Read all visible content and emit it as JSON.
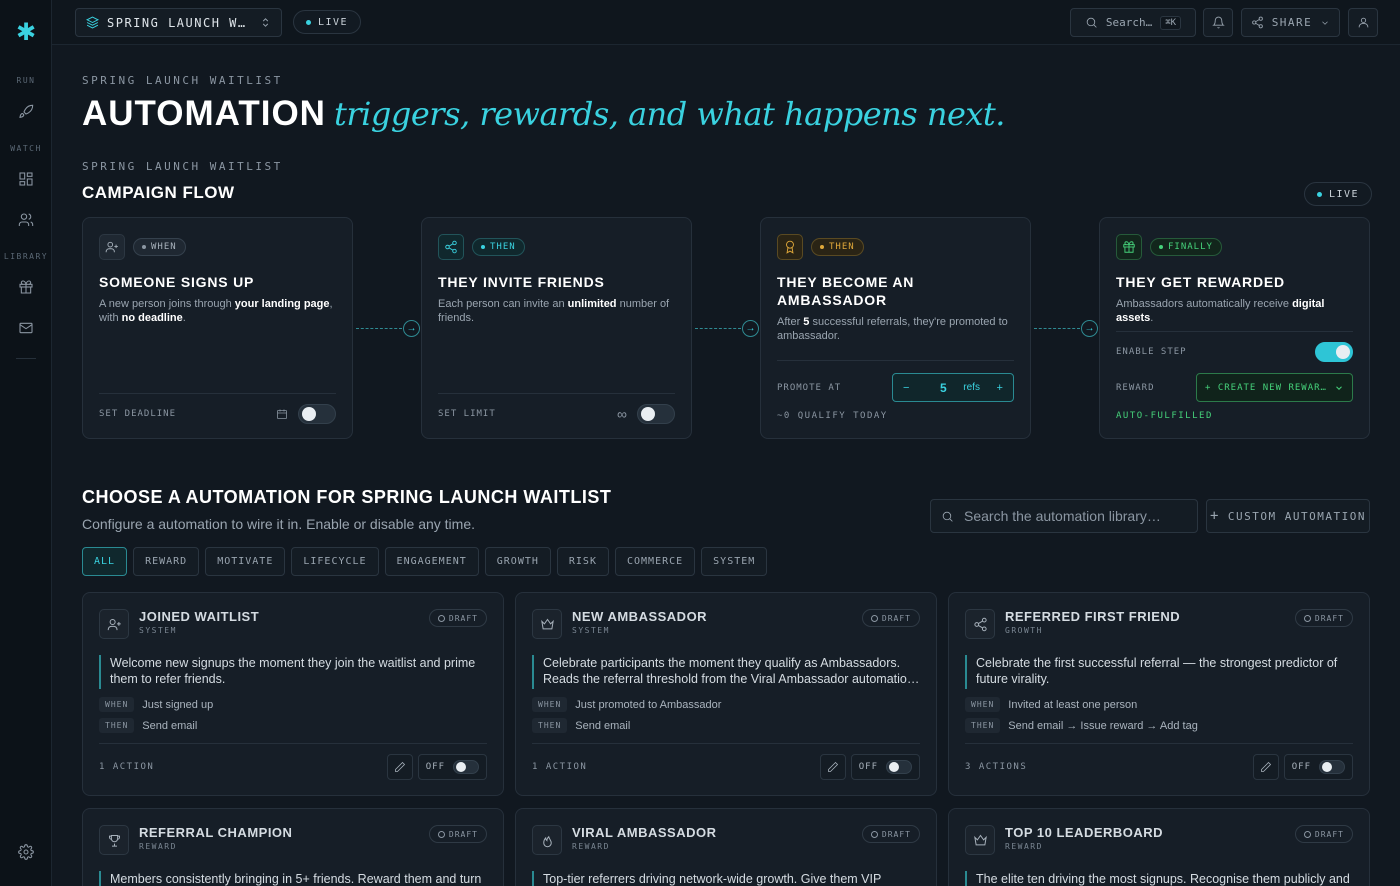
{
  "topbar": {
    "project": "SPRING LAUNCH WAI…",
    "live": "LIVE",
    "search_label": "Search…",
    "search_kbd": "⌘K",
    "share": "SHARE"
  },
  "sidebar": {
    "sections": [
      "RUN",
      "WATCH",
      "LIBRARY"
    ]
  },
  "header": {
    "eyebrow": "SPRING LAUNCH WAITLIST",
    "title": "AUTOMATION",
    "title_italic": "triggers, rewards, and what happens next."
  },
  "flow": {
    "eyebrow": "SPRING LAUNCH WAITLIST",
    "title": "CAMPAIGN FLOW",
    "live": "LIVE",
    "cards": [
      {
        "pill": "WHEN",
        "title": "SOMEONE SIGNS UP",
        "desc_pre": "A new person joins through ",
        "desc_b1": "your landing page",
        "desc_mid": ", with ",
        "desc_b2": "no deadline",
        "desc_post": ".",
        "foot_label": "SET DEADLINE"
      },
      {
        "pill": "THEN",
        "title": "THEY INVITE FRIENDS",
        "desc_pre": "Each person can invite an ",
        "desc_b1": "unlimited",
        "desc_mid": " number of friends.",
        "foot_label": "SET LIMIT"
      },
      {
        "pill": "THEN",
        "title": "THEY BECOME AN AMBASSADOR",
        "desc_pre": "After ",
        "desc_b1": "5",
        "desc_mid": " successful referrals, they're promoted to ambassador.",
        "foot_label": "PROMOTE AT",
        "stepper_minus": "−",
        "stepper_value": "5",
        "stepper_unit": "refs",
        "stepper_plus": "+",
        "qualify": "~0 QUALIFY TODAY"
      },
      {
        "pill": "FINALLY",
        "title": "THEY GET REWARDED",
        "desc_pre": "Ambassadors automatically receive ",
        "desc_b1": "digital assets",
        "desc_mid": ".",
        "enable_label": "ENABLE STEP",
        "reward_label": "REWARD",
        "reward_value": "+ CREATE NEW REWARD…",
        "auto": "AUTO-FULFILLED"
      }
    ]
  },
  "library": {
    "title": "CHOOSE A AUTOMATION FOR SPRING LAUNCH WAITLIST",
    "subtitle": "Configure a automation to wire it in. Enable or disable any time.",
    "search_placeholder": "Search the automation library…",
    "custom": "CUSTOM AUTOMATION",
    "filters": [
      "ALL",
      "REWARD",
      "MOTIVATE",
      "LIFECYCLE",
      "ENGAGEMENT",
      "GROWTH",
      "RISK",
      "COMMERCE",
      "SYSTEM"
    ],
    "draft": "DRAFT",
    "when": "WHEN",
    "then": "THEN",
    "off": "OFF",
    "cards": [
      {
        "title": "JOINED WAITLIST",
        "cat": "SYSTEM",
        "desc": "Welcome new signups the moment they join the waitlist and prime them to refer friends.",
        "when": "Just signed up",
        "then": "Send email",
        "actions": "1 ACTION"
      },
      {
        "title": "NEW AMBASSADOR",
        "cat": "SYSTEM",
        "desc": "Celebrate participants the moment they qualify as Ambassadors. Reads the referral threshold from the Viral Ambassador automatio…",
        "when": "Just promoted to Ambassador",
        "then": "Send email",
        "actions": "1 ACTION"
      },
      {
        "title": "REFERRED FIRST FRIEND",
        "cat": "GROWTH",
        "desc": "Celebrate the first successful referral — the strongest predictor of future virality.",
        "when": "Invited at least one person",
        "then": "Send email → Issue reward → Add tag",
        "actions": "3 ACTIONS"
      },
      {
        "title": "REFERRAL CHAMPION",
        "cat": "REWARD",
        "desc": "Members consistently bringing in 5+ friends. Reward them and turn"
      },
      {
        "title": "VIRAL AMBASSADOR",
        "cat": "REWARD",
        "desc": "Top-tier referrers driving network-wide growth. Give them VIP"
      },
      {
        "title": "TOP 10 LEADERBOARD",
        "cat": "REWARD",
        "desc": "The elite ten driving the most signups. Recognise them publicly and"
      }
    ]
  }
}
